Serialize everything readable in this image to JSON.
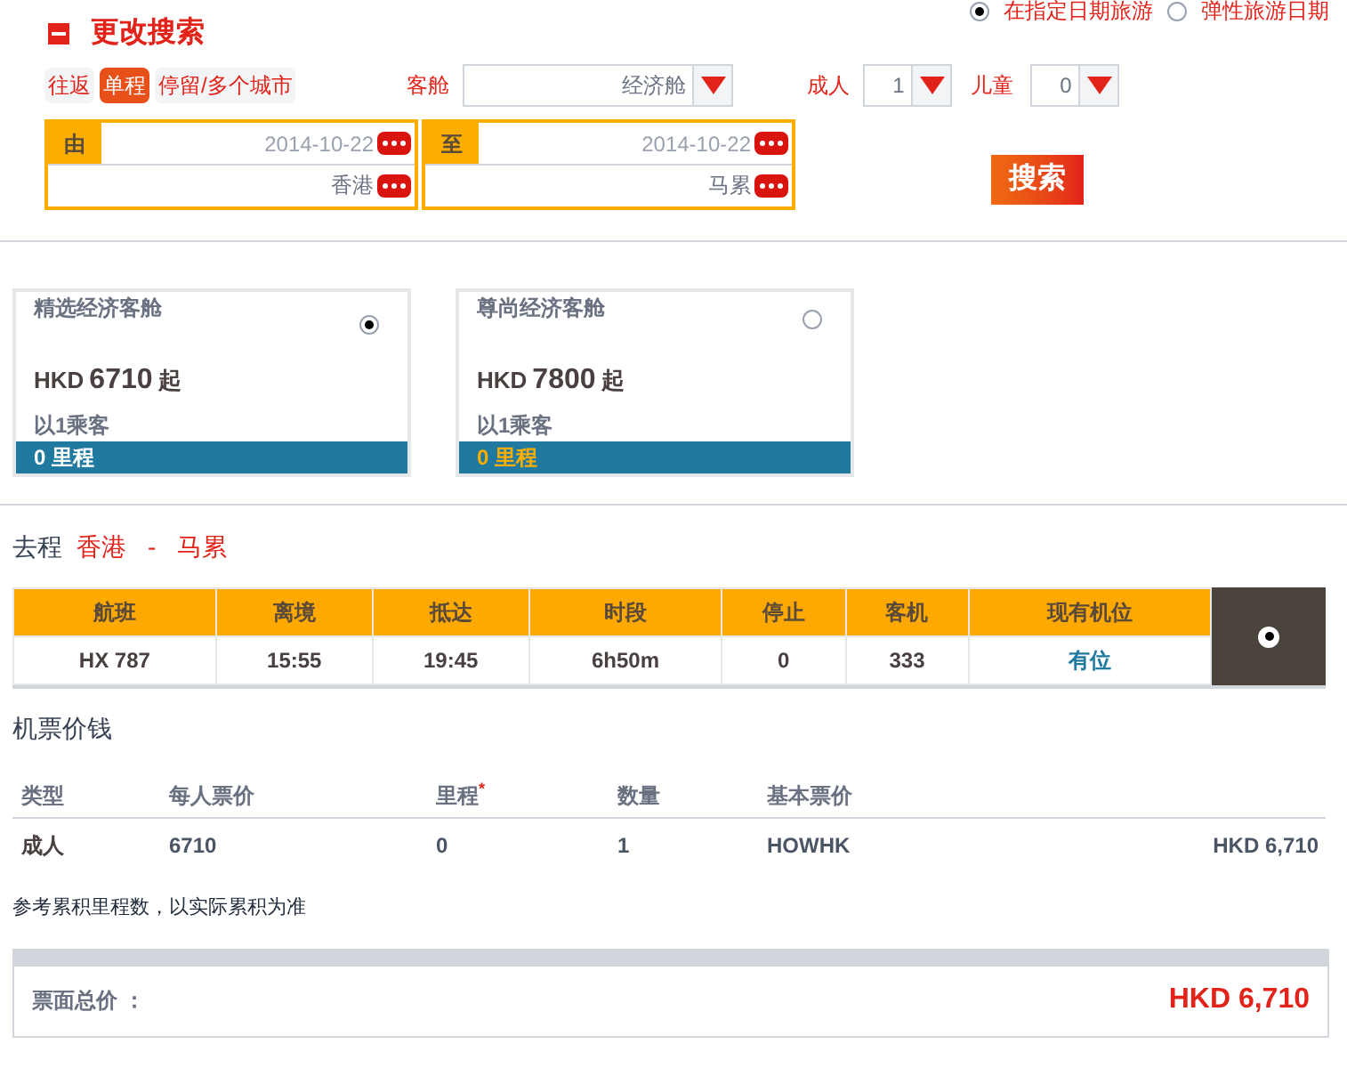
{
  "search": {
    "title": "更改搜索",
    "date_modes": [
      {
        "label": "在指定日期旅游",
        "selected": true
      },
      {
        "label": "弹性旅游日期",
        "selected": false
      }
    ],
    "trip_types": [
      {
        "label": "往返",
        "selected": false
      },
      {
        "label": "单程",
        "selected": true
      },
      {
        "label": "停留/多个城市",
        "selected": false
      }
    ],
    "cabin": {
      "label": "客舱",
      "value": "经济舱"
    },
    "adults": {
      "label": "成人",
      "value": "1"
    },
    "children": {
      "label": "儿童",
      "value": "0"
    },
    "legs": [
      {
        "label": "由",
        "date": "2014-10-22",
        "city": "香港"
      },
      {
        "label": "至",
        "date": "2014-10-22",
        "city": "马累"
      }
    ],
    "button": "搜索"
  },
  "fares": [
    {
      "name": "精选经济客舱",
      "currency": "HKD",
      "price": "6710",
      "suffix": "起",
      "per": "以1乘客",
      "miles": "0 里程",
      "selected": true
    },
    {
      "name": "尊尚经济客舱",
      "currency": "HKD",
      "price": "7800",
      "suffix": "起",
      "per": "以1乘客",
      "miles": "0 里程",
      "selected": false
    }
  ],
  "outbound": {
    "label": "去程",
    "from": "香港",
    "sep": "-",
    "to": "马累"
  },
  "flights": {
    "columns": [
      "航班",
      "离境",
      "抵达",
      "时段",
      "停止",
      "客机",
      "现有机位"
    ],
    "rows": [
      {
        "cells": [
          "HX 787",
          "15:55",
          "19:45",
          "6h50m",
          "0",
          "333",
          "有位"
        ],
        "selected": true
      }
    ]
  },
  "pricing": {
    "title": "机票价钱",
    "columns": [
      "类型",
      "每人票价",
      "里程$^{*}$",
      "数量",
      "基本票价"
    ],
    "rows": [
      {
        "cells": [
          "成人",
          "6710",
          "0",
          "1",
          "HOWHK",
          "HKD 6,710"
        ]
      }
    ],
    "note": "参考累积里程数，以实际累积为准",
    "total_label": "票面总价 ：",
    "total": "HKD 6,710"
  }
}
